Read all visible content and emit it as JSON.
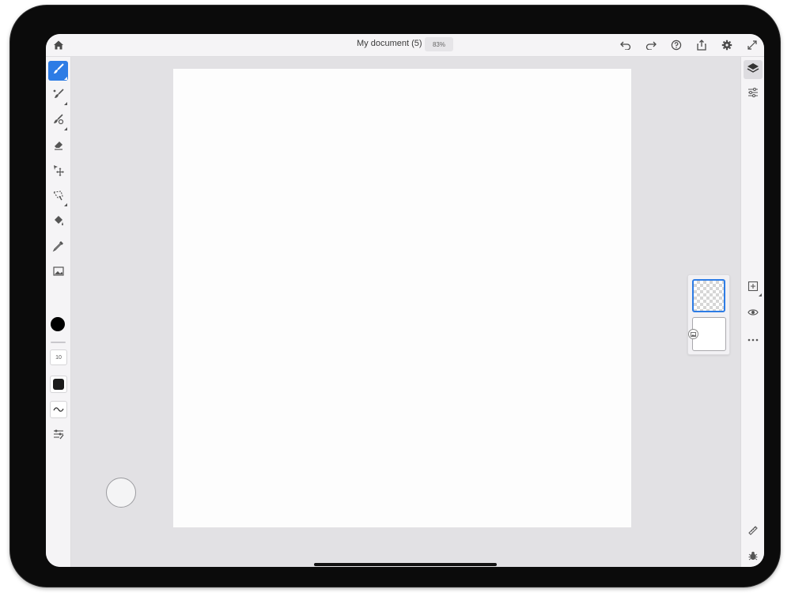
{
  "document": {
    "title": "My document (5)",
    "zoom": "83%"
  },
  "topbar": {
    "left_icons": [
      "home-icon"
    ],
    "right_icons": [
      "undo-icon",
      "redo-icon",
      "help-icon",
      "share-icon",
      "settings-icon",
      "fullscreen-icon"
    ]
  },
  "left_toolbar": {
    "tools": [
      {
        "name": "brush-tool",
        "icon": "paint-brush-icon",
        "active": true
      },
      {
        "name": "mixer-brush-tool",
        "icon": "mixer-brush-icon",
        "active": false
      },
      {
        "name": "smudge-tool",
        "icon": "smudge-icon",
        "active": false
      },
      {
        "name": "eraser-tool",
        "icon": "eraser-icon",
        "active": false
      },
      {
        "name": "move-tool",
        "icon": "move-icon",
        "active": false
      },
      {
        "name": "lasso-tool",
        "icon": "lasso-icon",
        "active": false
      },
      {
        "name": "fill-tool",
        "icon": "paint-bucket-icon",
        "active": false
      },
      {
        "name": "eyedropper-tool",
        "icon": "eyedropper-icon",
        "active": false
      },
      {
        "name": "image-tool",
        "icon": "image-icon",
        "active": false
      }
    ],
    "color": "#000000",
    "brush_size": "10",
    "brush_shape": "square",
    "smoothing": "wave-icon",
    "brush_settings": "brush-settings-icon"
  },
  "right_toolbar": {
    "top_tools": [
      "layers-icon",
      "adjustments-icon"
    ],
    "layer_actions": [
      "add-layer-icon",
      "visibility-icon",
      "more-icon"
    ],
    "bottom_tools": [
      "ruler-icon",
      "bug-icon"
    ]
  },
  "layers": [
    {
      "name": "layer-1",
      "type": "transparent",
      "selected": true
    },
    {
      "name": "background-layer",
      "type": "image",
      "selected": false
    }
  ],
  "colors": {
    "accent": "#2d7ce5",
    "workspace": "#e2e1e4",
    "toolbar": "#f5f4f6"
  }
}
